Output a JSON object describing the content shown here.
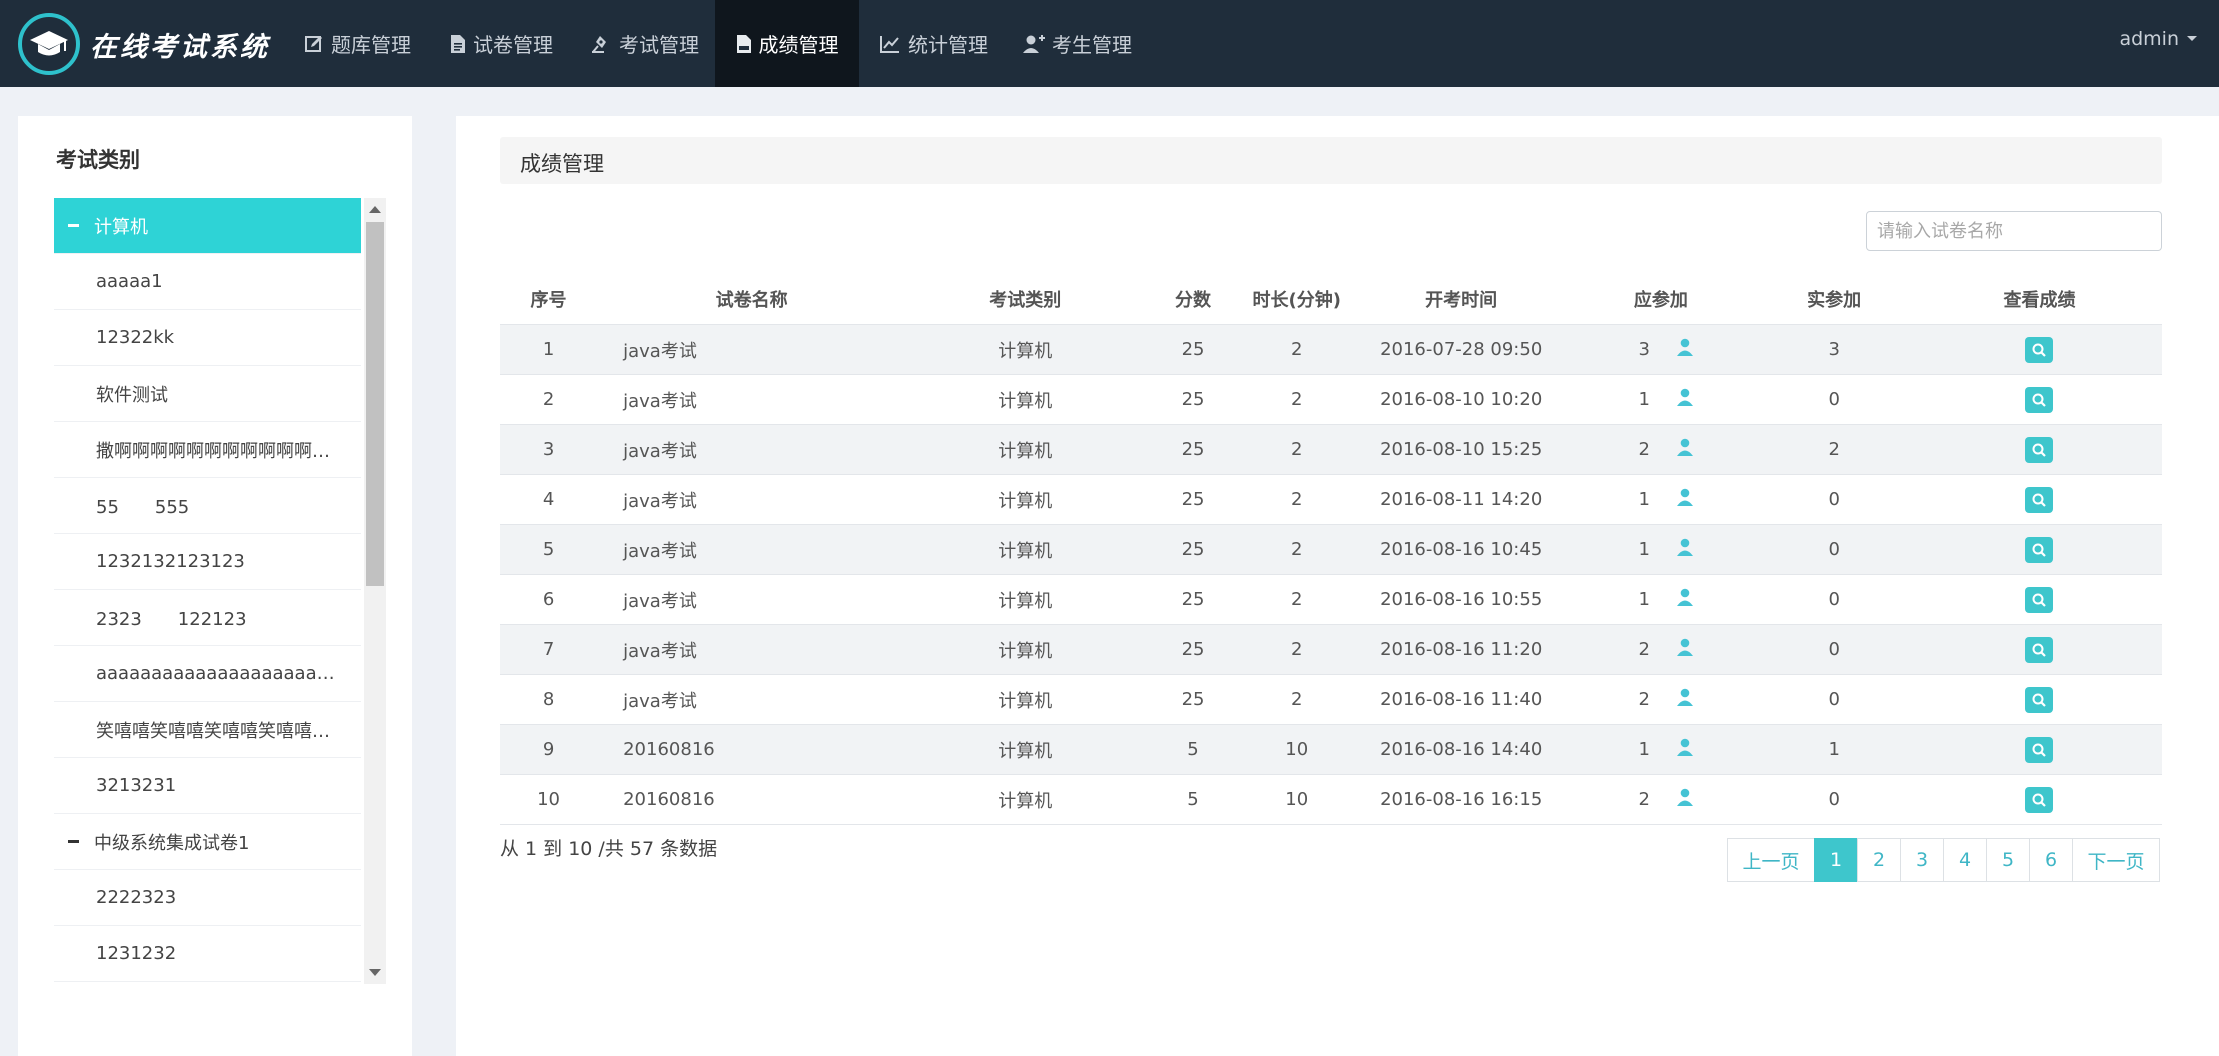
{
  "brand": {
    "title": "在线考试系统"
  },
  "nav": [
    {
      "label": "题库管理",
      "icon": "edit-square-icon"
    },
    {
      "label": "试卷管理",
      "icon": "document-icon"
    },
    {
      "label": "考试管理",
      "icon": "pen-stamp-icon"
    },
    {
      "label": "成绩管理",
      "icon": "pdf-file-icon",
      "active": true
    },
    {
      "label": "统计管理",
      "icon": "line-chart-icon"
    },
    {
      "label": "考生管理",
      "icon": "add-user-icon"
    }
  ],
  "user": {
    "name": "admin"
  },
  "sidebar": {
    "title": "考试类别",
    "items": [
      {
        "label": "计算机",
        "group": true,
        "active": true
      },
      {
        "label": "aaaaa1"
      },
      {
        "label": "12322kk"
      },
      {
        "label": "软件测试"
      },
      {
        "label": "撒啊啊啊啊啊啊啊啊啊啊啊啊啊啊啊"
      },
      {
        "label": "55　　555"
      },
      {
        "label": "1232132123123"
      },
      {
        "label": "2323　　122123"
      },
      {
        "label": "aaaaaaaaaaaaaaaaaaaaaaaaaaaa"
      },
      {
        "label": "笑嘻嘻笑嘻嘻笑嘻嘻笑嘻嘻笑嘻嘻"
      },
      {
        "label": "3213231"
      },
      {
        "label": "中级系统集成试卷1",
        "group": true
      },
      {
        "label": "2222323"
      },
      {
        "label": "1231232"
      }
    ]
  },
  "main": {
    "header": "成绩管理",
    "search": {
      "placeholder": "请输入试卷名称"
    },
    "columns": [
      "序号",
      "试卷名称",
      "考试类别",
      "分数",
      "时长(分钟)",
      "开考时间",
      "应参加",
      "实参加",
      "查看成绩"
    ],
    "rows": [
      {
        "no": "1",
        "name": "java考试",
        "category": "计算机",
        "score": "25",
        "duration": "2",
        "start": "2016-07-28 09:50",
        "expected": "3",
        "actual": "3"
      },
      {
        "no": "2",
        "name": "java考试",
        "category": "计算机",
        "score": "25",
        "duration": "2",
        "start": "2016-08-10 10:20",
        "expected": "1",
        "actual": "0"
      },
      {
        "no": "3",
        "name": "java考试",
        "category": "计算机",
        "score": "25",
        "duration": "2",
        "start": "2016-08-10 15:25",
        "expected": "2",
        "actual": "2"
      },
      {
        "no": "4",
        "name": "java考试",
        "category": "计算机",
        "score": "25",
        "duration": "2",
        "start": "2016-08-11 14:20",
        "expected": "1",
        "actual": "0"
      },
      {
        "no": "5",
        "name": "java考试",
        "category": "计算机",
        "score": "25",
        "duration": "2",
        "start": "2016-08-16 10:45",
        "expected": "1",
        "actual": "0"
      },
      {
        "no": "6",
        "name": "java考试",
        "category": "计算机",
        "score": "25",
        "duration": "2",
        "start": "2016-08-16 10:55",
        "expected": "1",
        "actual": "0"
      },
      {
        "no": "7",
        "name": "java考试",
        "category": "计算机",
        "score": "25",
        "duration": "2",
        "start": "2016-08-16 11:20",
        "expected": "2",
        "actual": "0"
      },
      {
        "no": "8",
        "name": "java考试",
        "category": "计算机",
        "score": "25",
        "duration": "2",
        "start": "2016-08-16 11:40",
        "expected": "2",
        "actual": "0"
      },
      {
        "no": "9",
        "name": "20160816",
        "category": "计算机",
        "score": "5",
        "duration": "10",
        "start": "2016-08-16 14:40",
        "expected": "1",
        "actual": "1"
      },
      {
        "no": "10",
        "name": "20160816",
        "category": "计算机",
        "score": "5",
        "duration": "10",
        "start": "2016-08-16 16:15",
        "expected": "2",
        "actual": "0"
      }
    ],
    "summary": "从 1 到 10 /共 57 条数据",
    "pagination": {
      "prev": "上一页",
      "pages": [
        "1",
        "2",
        "3",
        "4",
        "5",
        "6"
      ],
      "current": "1",
      "next": "下一页"
    }
  },
  "colors": {
    "navbar": "#1f2d3b",
    "accent": "#3ec6cc",
    "active_tree": "#2ed3d6",
    "link": "#3fb6c6"
  }
}
